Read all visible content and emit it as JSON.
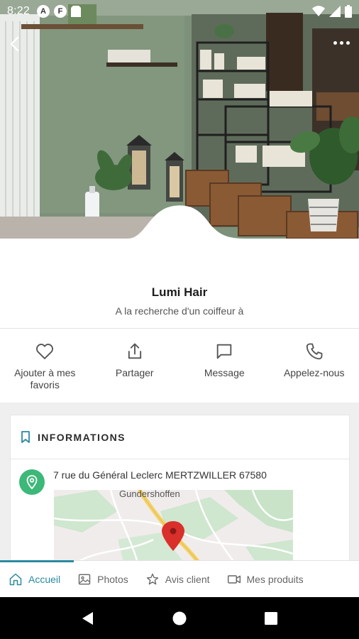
{
  "status_bar": {
    "time": "8:22",
    "notif_icons": [
      "A",
      "F"
    ]
  },
  "business": {
    "name": "Lumi Hair",
    "tagline": "A la recherche d'un coiffeur à"
  },
  "actions": [
    {
      "label": "Ajouter à mes favoris",
      "icon": "heart-icon"
    },
    {
      "label": "Partager",
      "icon": "share-icon"
    },
    {
      "label": "Message",
      "icon": "message-icon"
    },
    {
      "label": "Appelez-nous",
      "icon": "phone-icon"
    }
  ],
  "info_card": {
    "heading": "INFORMATIONS",
    "address": "7 rue du Général Leclerc MERTZWILLER 67580",
    "map_place": "Gundershoffen"
  },
  "tabs": [
    {
      "label": "Accueil",
      "icon": "home-icon",
      "active": true
    },
    {
      "label": "Photos",
      "icon": "image-icon",
      "active": false
    },
    {
      "label": "Avis client",
      "icon": "star-icon",
      "active": false
    },
    {
      "label": "Mes produits",
      "icon": "video-icon",
      "active": false
    }
  ],
  "colors": {
    "accent": "#2a8aa0",
    "pin_green": "#3cb878",
    "map_marker": "#d9302c"
  }
}
